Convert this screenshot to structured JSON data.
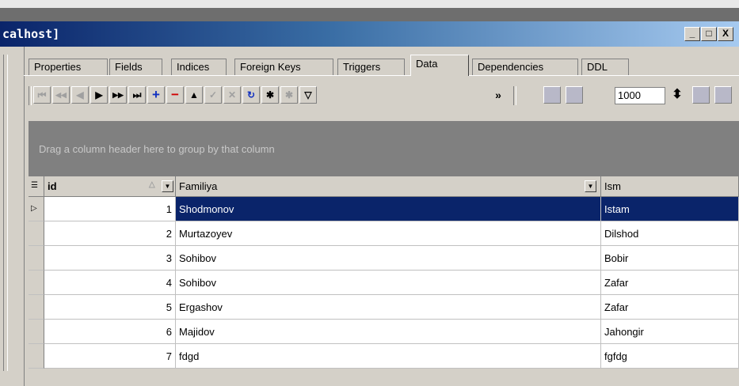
{
  "window": {
    "title": "calhost]",
    "minimize": "_",
    "maximize": "□",
    "close": "X"
  },
  "tabs": [
    {
      "label": "Properties",
      "active": false
    },
    {
      "label": "Fields",
      "active": false
    },
    {
      "label": "Indices",
      "active": false
    },
    {
      "label": "Foreign Keys",
      "active": false
    },
    {
      "label": "Triggers",
      "active": false
    },
    {
      "label": "Data",
      "active": true
    },
    {
      "label": "Dependencies",
      "active": false
    },
    {
      "label": "DDL",
      "active": false
    }
  ],
  "toolbar": {
    "first": "⏮",
    "prev_page": "◀◀",
    "prev": "◀",
    "next": "▶",
    "next_page": "▶▶",
    "last": "⏭",
    "insert": "+",
    "delete": "−",
    "edit": "▲",
    "post": "✓",
    "cancel": "✕",
    "refresh": "↻",
    "bookmark": "✱",
    "goto_bookmark": "✱",
    "filter": "▽",
    "more": "»",
    "rows_count": "1000",
    "spin": "⬍"
  },
  "group_hint": "Drag a column header here to group by that column",
  "grid": {
    "columns": [
      "id",
      "Familiya",
      "Ism"
    ],
    "rows": [
      {
        "id": "1",
        "familiya": "Shodmonov",
        "ism": "Istam",
        "selected": true
      },
      {
        "id": "2",
        "familiya": "Murtazoyev",
        "ism": "Dilshod",
        "selected": false
      },
      {
        "id": "3",
        "familiya": "Sohibov",
        "ism": "Bobir",
        "selected": false
      },
      {
        "id": "4",
        "familiya": "Sohibov",
        "ism": "Zafar",
        "selected": false
      },
      {
        "id": "5",
        "familiya": "Ergashov",
        "ism": "Zafar",
        "selected": false
      },
      {
        "id": "6",
        "familiya": "Majidov",
        "ism": "Jahongir",
        "selected": false
      },
      {
        "id": "7",
        "familiya": "fdgd",
        "ism": "fgfdg",
        "selected": false
      }
    ]
  },
  "colors": {
    "selection": "#0a246a",
    "title_start": "#0a246a",
    "title_end": "#a6caf0"
  }
}
